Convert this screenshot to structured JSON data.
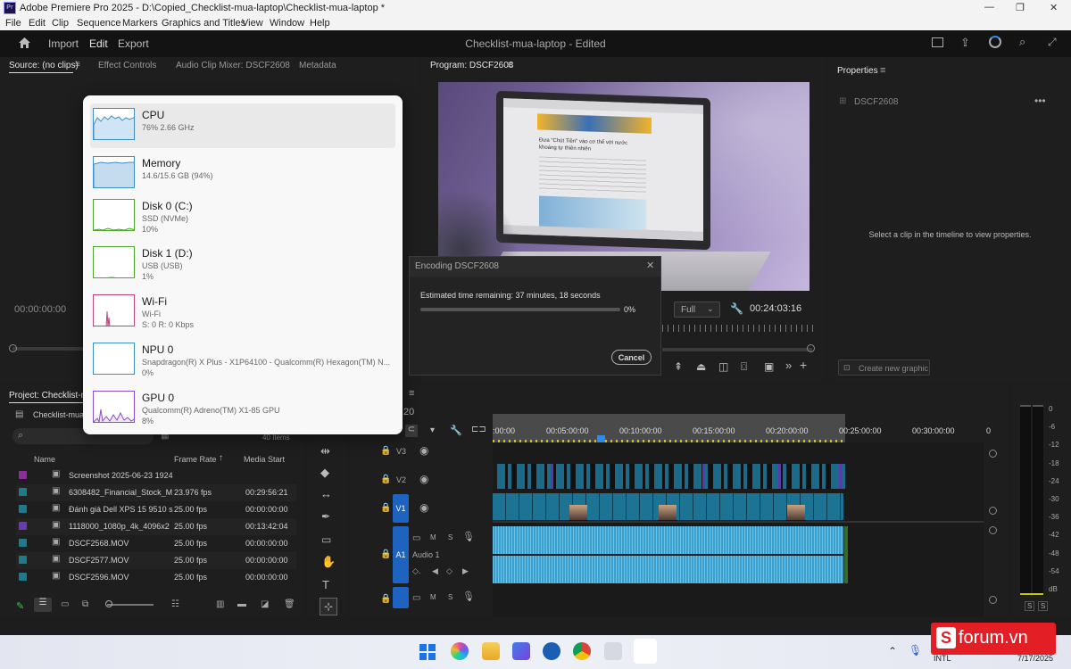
{
  "window": {
    "title": "Adobe Premiere Pro 2025 - D:\\Copied_Checklist-mua-laptop\\Checklist-mua-laptop *",
    "app_icon": "Pr"
  },
  "menu": [
    "File",
    "Edit",
    "Clip",
    "Sequence",
    "Markers",
    "Graphics and Titles",
    "View",
    "Window",
    "Help"
  ],
  "header": {
    "nav": [
      "Import",
      "Edit",
      "Export"
    ],
    "active_nav": "Edit",
    "project_title": "Checklist-mua-laptop - Edited"
  },
  "source_panel": {
    "tabs": [
      "Source: (no clips)",
      "Effect Controls",
      "Audio Clip Mixer: DSCF2608",
      "Metadata"
    ],
    "timecode": "00:00:00:00"
  },
  "program_panel": {
    "tab": "Program: DSCF2608",
    "quality": "Full",
    "duration": "00:24:03:16",
    "screen_text": {
      "headline": "Đưa \"Chút Tiền\" vào cơ thể với nước khoáng tự thiên nhiên"
    }
  },
  "properties_panel": {
    "tab": "Properties",
    "clip_name": "DSCF2608",
    "empty_message": "Select a clip in the timeline to view properties.",
    "create_graphic": "Create new graphic"
  },
  "task_manager": {
    "items": [
      {
        "name": "CPU",
        "line1": "76%  2.66 GHz",
        "line2": "",
        "color": "#3d8ec9",
        "fill": "#cfe5f5"
      },
      {
        "name": "Memory",
        "line1": "14.6/15.6 GB (94%)",
        "line2": "",
        "color": "#3d8ec9",
        "fill": "#c5dcef"
      },
      {
        "name": "Disk 0 (C:)",
        "line1": "SSD (NVMe)",
        "line2": "10%",
        "color": "#4ea72e",
        "fill": "#e6f3df"
      },
      {
        "name": "Disk 1 (D:)",
        "line1": "USB (USB)",
        "line2": "1%",
        "color": "#4ea72e",
        "fill": "#e6f3df"
      },
      {
        "name": "Wi-Fi",
        "line1": "Wi-Fi",
        "line2": "S: 0  R: 0 Kbps",
        "color": "#c0457a",
        "fill": "#fbe7ef"
      },
      {
        "name": "NPU 0",
        "line1": "Snapdragon(R) X Plus - X1P64100 - Qualcomm(R) Hexagon(TM) N...",
        "line2": "0%",
        "color": "#3d8ec9",
        "fill": "#ffffff"
      },
      {
        "name": "GPU 0",
        "line1": "Qualcomm(R) Adreno(TM) X1-85 GPU",
        "line2": "8%",
        "color": "#8b4fc4",
        "fill": "#efe4f8"
      }
    ]
  },
  "encoding_dialog": {
    "title": "Encoding DSCF2608",
    "estimate": "Estimated time remaining: 37 minutes, 18 seconds",
    "progress_percent": 0,
    "progress_label": "0%",
    "cancel": "Cancel"
  },
  "project_panel": {
    "tab": "Project: Checklist-mua",
    "bin": "Checklist-mua",
    "item_count": "40 Items",
    "columns": [
      "Name",
      "Frame Rate",
      "Media Start"
    ],
    "rows": [
      {
        "name": "Screenshot 2025-06-23 1924",
        "fps": "",
        "start": "",
        "color": "#8a2f9a"
      },
      {
        "name": "6308482_Financial_Stock_M",
        "fps": "23.976 fps",
        "start": "00:29:56:21",
        "color": "#1f7a8c"
      },
      {
        "name": "Đánh giá Dell XPS 15 9510 s",
        "fps": "25.00 fps",
        "start": "00:00:00:00",
        "color": "#1f7a8c"
      },
      {
        "name": "1118000_1080p_4k_4096x2",
        "fps": "25.00 fps",
        "start": "00:13:42:04",
        "color": "#6a3ab3"
      },
      {
        "name": "DSCF2568.MOV",
        "fps": "25.00 fps",
        "start": "00:00:00:00",
        "color": "#1f7a8c"
      },
      {
        "name": "DSCF2577.MOV",
        "fps": "25.00 fps",
        "start": "00:00:00:00",
        "color": "#1f7a8c"
      },
      {
        "name": "DSCF2596.MOV",
        "fps": "25.00 fps",
        "start": "00:00:00:00",
        "color": "#1f7a8c"
      }
    ]
  },
  "timeline": {
    "timecode_fragment": "20",
    "ruler": [
      ":00:00",
      "00:05:00:00",
      "00:10:00:00",
      "00:15:00:00",
      "00:20:00:00",
      "00:25:00:00",
      "00:30:00:00",
      "0"
    ],
    "tracks": {
      "v3": "V3",
      "v2": "V2",
      "v1": "V1",
      "a1": "A1",
      "a1_name": "Audio 1"
    },
    "audio_buttons": [
      "M",
      "S"
    ]
  },
  "meter": {
    "scale": [
      "0",
      "-6",
      "-12",
      "-18",
      "-24",
      "-30",
      "-36",
      "-42",
      "-48",
      "-54",
      "dB"
    ],
    "solo": [
      "S",
      "S"
    ]
  },
  "taskbar": {
    "lang": "INTL",
    "date": "7/17/2025"
  },
  "watermark": "forum.vn"
}
